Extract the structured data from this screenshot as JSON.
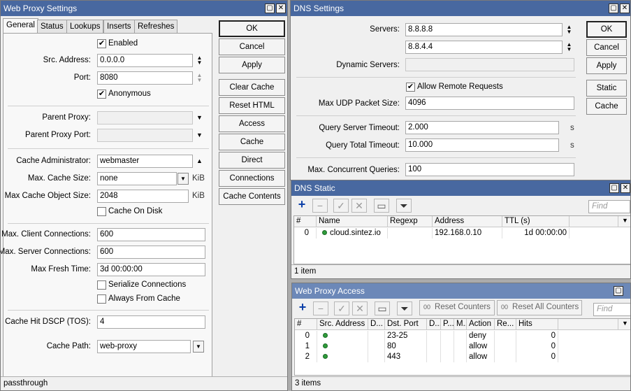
{
  "web_proxy": {
    "title": "Web Proxy Settings",
    "tabs": [
      "General",
      "Status",
      "Lookups",
      "Inserts",
      "Refreshes"
    ],
    "enabled_label": "Enabled",
    "enabled_checked": true,
    "src_address_label": "Src. Address:",
    "src_address_value": "0.0.0.0",
    "port_label": "Port:",
    "port_value": "8080",
    "anonymous_label": "Anonymous",
    "parent_proxy_label": "Parent Proxy:",
    "parent_proxy_port_label": "Parent Proxy Port:",
    "cache_admin_label": "Cache Administrator:",
    "cache_admin_value": "webmaster",
    "max_cache_size_label": "Max. Cache Size:",
    "max_cache_size_value": "none",
    "max_cache_size_unit": "KiB",
    "max_cache_object_label": "Max Cache Object Size:",
    "max_cache_object_value": "2048",
    "max_cache_object_unit": "KiB",
    "cache_on_disk_label": "Cache On Disk",
    "max_client_conn_label": "Max. Client Connections:",
    "max_client_conn_value": "600",
    "max_server_conn_label": "Max. Server Connections:",
    "max_server_conn_value": "600",
    "max_fresh_time_label": "Max Fresh Time:",
    "max_fresh_time_value": "3d 00:00:00",
    "serialize_label": "Serialize Connections",
    "always_from_cache_label": "Always From Cache",
    "cache_hit_dscp_label": "Cache Hit DSCP (TOS):",
    "cache_hit_dscp_value": "4",
    "cache_path_label": "Cache Path:",
    "cache_path_value": "web-proxy",
    "status_text": "passthrough",
    "buttons": [
      "OK",
      "Cancel",
      "Apply",
      "Clear Cache",
      "Reset HTML",
      "Access",
      "Cache",
      "Direct",
      "Connections",
      "Cache Contents"
    ]
  },
  "dns": {
    "title": "DNS Settings",
    "servers_label": "Servers:",
    "server1": "8.8.8.8",
    "server2": "8.8.4.4",
    "dynamic_servers_label": "Dynamic Servers:",
    "allow_remote_label": "Allow Remote Requests",
    "max_udp_label": "Max UDP Packet Size:",
    "max_udp_value": "4096",
    "query_server_timeout_label": "Query Server Timeout:",
    "query_server_timeout_value": "2.000",
    "query_total_timeout_label": "Query Total Timeout:",
    "query_total_timeout_value": "10.000",
    "timeout_unit": "s",
    "max_concurrent_label": "Max. Concurrent Queries:",
    "max_concurrent_value": "100",
    "buttons": [
      "OK",
      "Cancel",
      "Apply",
      "Static",
      "Cache"
    ]
  },
  "dns_static": {
    "title": "DNS Static",
    "find_placeholder": "Find",
    "columns": [
      "#",
      "Name",
      "Regexp",
      "Address",
      "TTL (s)"
    ],
    "rows": [
      {
        "num": "0",
        "name": "cloud.sintez.io",
        "regexp": "",
        "address": "192.168.0.10",
        "ttl": "1d 00:00:00"
      }
    ],
    "status": "1 item"
  },
  "proxy_access": {
    "title": "Web Proxy Access",
    "find_placeholder": "Find",
    "reset_counters": "Reset Counters",
    "reset_all_counters": "Reset All Counters",
    "counter_icon_text": "00",
    "columns": [
      "#",
      "Src. Address",
      "D...",
      "Dst. Port",
      "D...",
      "P...",
      "M...",
      "Action",
      "Re...",
      "Hits"
    ],
    "rows": [
      {
        "num": "0",
        "dst_port": "23-25",
        "action": "deny",
        "hits": "0"
      },
      {
        "num": "1",
        "dst_port": "80",
        "action": "allow",
        "hits": "0"
      },
      {
        "num": "2",
        "dst_port": "443",
        "action": "allow",
        "hits": "0"
      }
    ],
    "status": "3 items"
  },
  "icons": {
    "maximize": "maximize-icon",
    "close": "close-icon",
    "add": "plus-icon",
    "remove": "minus-icon",
    "enable": "check-icon",
    "disable": "cross-icon",
    "comment": "comment-icon",
    "filter": "filter-icon"
  },
  "colors": {
    "titlebar": "#4868a0",
    "status_dot": "#2e9c3a",
    "add_icon": "#0b3fa8"
  }
}
